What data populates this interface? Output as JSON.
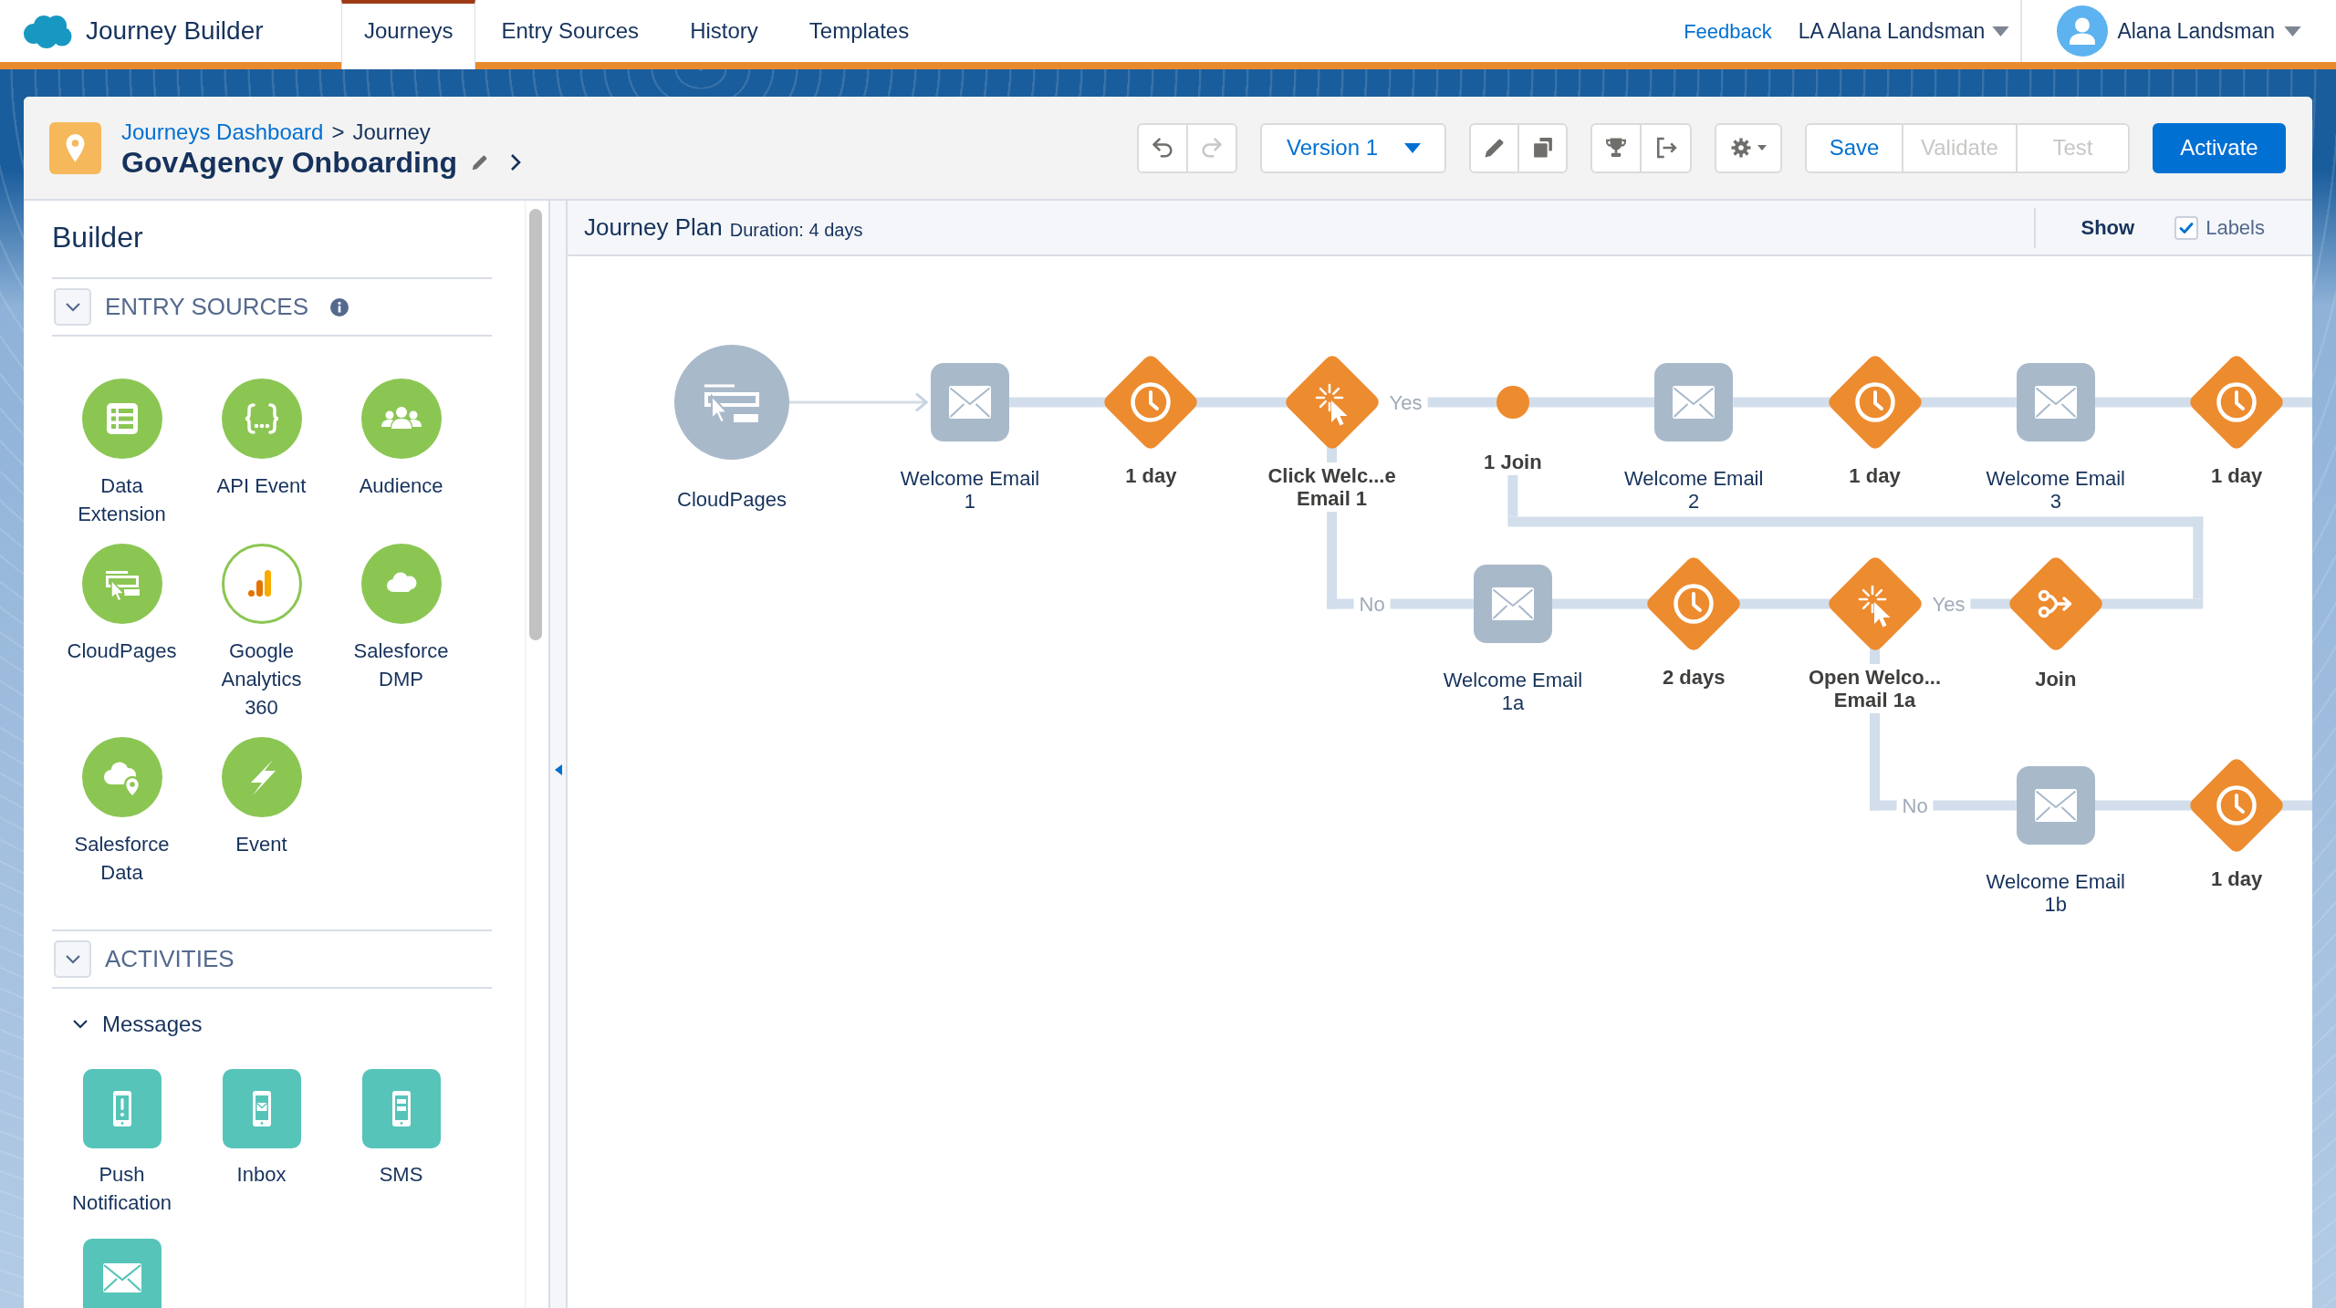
{
  "app": {
    "title": "Journey Builder"
  },
  "nav_tabs": [
    {
      "label": "Journeys",
      "selected": true
    },
    {
      "label": "Entry Sources",
      "selected": false
    },
    {
      "label": "History",
      "selected": false
    },
    {
      "label": "Templates",
      "selected": false
    }
  ],
  "user_bar": {
    "feedback": "Feedback",
    "org": "LA Alana Landsman",
    "user_name": "Alana Landsman"
  },
  "header": {
    "breadcrumb": {
      "link": "Journeys Dashboard",
      "separator": ">",
      "current": "Journey"
    },
    "title": "GovAgency Onboarding"
  },
  "toolbar": {
    "history_buttons": [
      {
        "disabled": false
      },
      {
        "disabled": true
      }
    ],
    "version": "Version 1",
    "actions": [
      {
        "label": "Save",
        "disabled": false
      },
      {
        "label": "Validate",
        "disabled": true
      },
      {
        "label": "Test",
        "disabled": true
      }
    ],
    "primary_action": "Activate"
  },
  "builder": {
    "title": "Builder",
    "sections": [
      {
        "title": "ENTRY SOURCES",
        "expanded": true,
        "info": true,
        "items": [
          {
            "kind": "list",
            "label": "Data\nExtension"
          },
          {
            "kind": "braces",
            "label": "API Event"
          },
          {
            "kind": "group",
            "label": "Audience"
          },
          {
            "kind": "webpage",
            "label": "CloudPages"
          },
          {
            "kind": "chart",
            "label": "Google\nAnalytics\n360"
          },
          {
            "kind": "cloud",
            "label": "Salesforce\nDMP"
          },
          {
            "kind": "location",
            "label": "Salesforce\nData"
          },
          {
            "kind": "bolt",
            "label": "Event"
          }
        ]
      },
      {
        "title": "ACTIVITIES",
        "expanded": true,
        "groups": [
          {
            "title": "Messages",
            "expanded": true,
            "items": [
              {
                "kind": "push",
                "label": "Push\nNotification"
              },
              {
                "kind": "inbox",
                "label": "Inbox"
              },
              {
                "kind": "sms",
                "label": "SMS"
              },
              {
                "kind": "email"
              }
            ]
          }
        ]
      }
    ]
  },
  "canvas": {
    "title": "Journey Plan",
    "duration": "Duration: 4 days",
    "show_label": "Show",
    "labels_option": {
      "label": "Labels",
      "checked": true
    },
    "entry": {
      "kind": "entry",
      "label": "CloudPages"
    },
    "steps": [
      {
        "kind": "email",
        "label": "Welcome Email\n1"
      },
      {
        "kind": "wait",
        "label": "1 day"
      },
      {
        "kind": "decision",
        "label": "Click Welc...e\nEmail 1",
        "yes_label": "Yes",
        "no_label": "No",
        "no_path": [
          {
            "kind": "email",
            "label": "Welcome Email\n1a"
          },
          {
            "kind": "wait",
            "label": "2 days"
          },
          {
            "kind": "decision",
            "label": "Open Welco...\nEmail 1a",
            "yes_label": "Yes",
            "no_label": "No",
            "no_path": [
              {
                "kind": "email",
                "label": "Welcome Email\n1b"
              },
              {
                "kind": "wait",
                "label": "1 day"
              }
            ]
          },
          {
            "kind": "join",
            "label": "Join"
          }
        ]
      },
      {
        "kind": "joinpoint",
        "label": "1 Join"
      },
      {
        "kind": "email",
        "label": "Welcome Email\n2"
      },
      {
        "kind": "wait",
        "label": "1 day"
      },
      {
        "kind": "email",
        "label": "Welcome Email\n3"
      },
      {
        "kind": "wait",
        "label": "1 day"
      }
    ]
  }
}
